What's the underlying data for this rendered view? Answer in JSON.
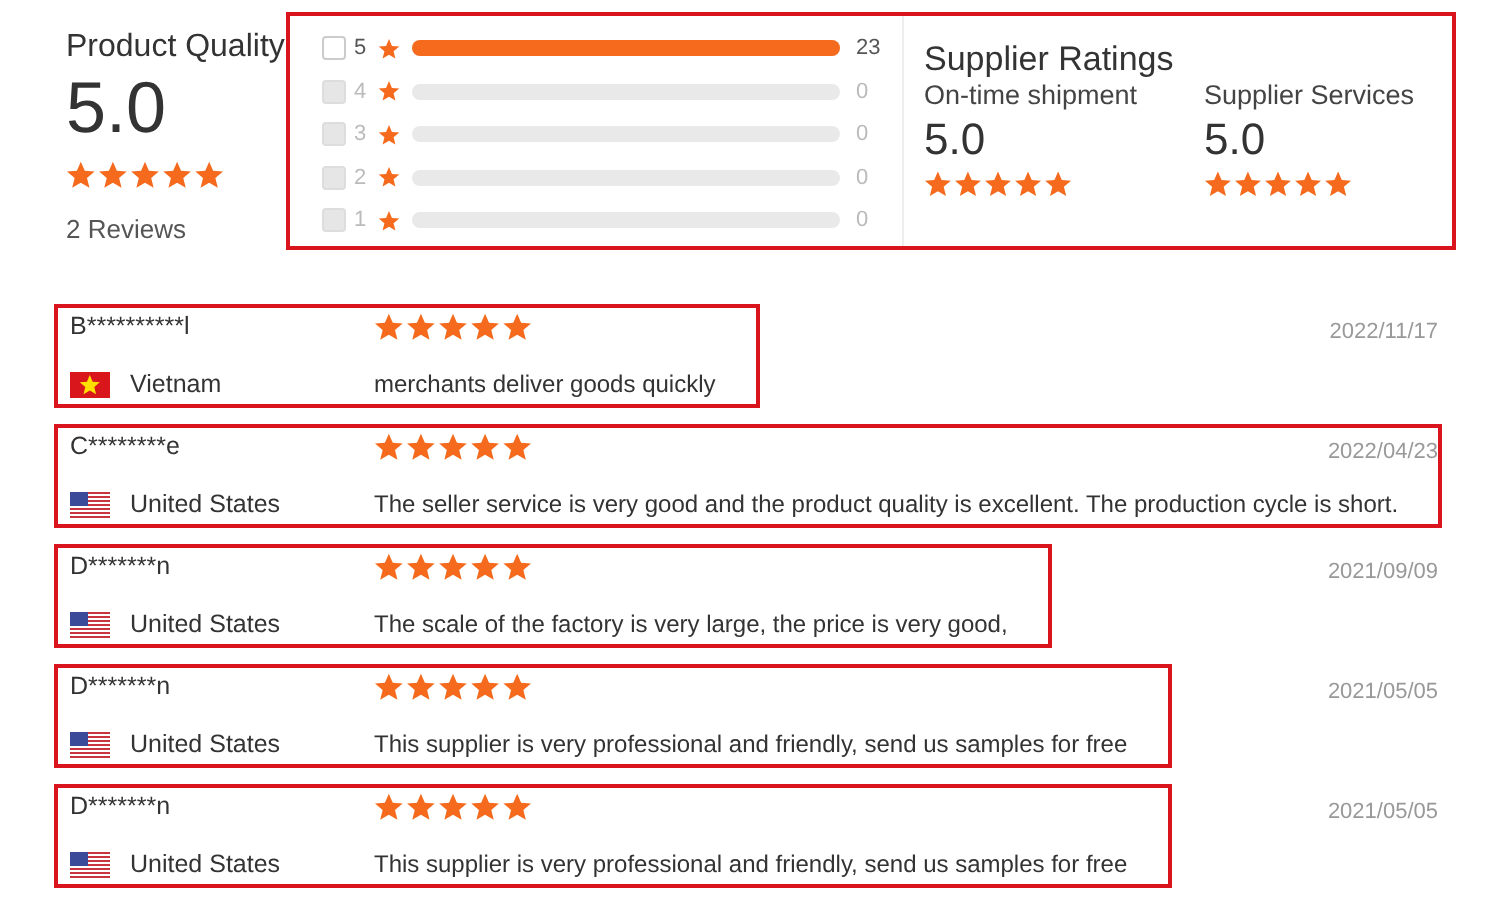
{
  "product_quality": {
    "title": "Product Quality",
    "score": "5.0",
    "stars": 5,
    "reviews_count": "2 Reviews"
  },
  "distribution": [
    {
      "label": "5",
      "disabled": false,
      "level": 1,
      "count": "23"
    },
    {
      "label": "4",
      "disabled": true,
      "level": 0,
      "count": "0"
    },
    {
      "label": "3",
      "disabled": true,
      "level": 0,
      "count": "0"
    },
    {
      "label": "2",
      "disabled": true,
      "level": 0,
      "count": "0"
    },
    {
      "label": "1",
      "disabled": true,
      "level": 0,
      "count": "0"
    }
  ],
  "supplier_ratings": {
    "title": "Supplier Ratings",
    "items": [
      {
        "label": "On-time shipment",
        "score": "5.0",
        "stars": 5
      },
      {
        "label": "Supplier Services",
        "score": "5.0",
        "stars": 5
      }
    ]
  },
  "reviews": [
    {
      "name": "B**********l",
      "country": {
        "name": "Vietnam",
        "kind": "vn"
      },
      "stars": 5,
      "comment": "merchants deliver goods quickly",
      "date": "2022/11/17"
    },
    {
      "name": "C********e",
      "country": {
        "name": "United States",
        "kind": "us"
      },
      "stars": 5,
      "comment": "The seller service is very good and the product quality is excellent. The production cycle is short.",
      "date": "2022/04/23"
    },
    {
      "name": "D*******n",
      "country": {
        "name": "United States",
        "kind": "us"
      },
      "stars": 5,
      "comment": "The scale of the factory is very large, the price is very good,",
      "date": "2021/09/09"
    },
    {
      "name": "D*******n",
      "country": {
        "name": "United States",
        "kind": "us"
      },
      "stars": 5,
      "comment": "This supplier is very professional and friendly, send us samples for free",
      "date": "2021/05/05"
    },
    {
      "name": "D*******n",
      "country": {
        "name": "United States",
        "kind": "us"
      },
      "stars": 5,
      "comment": "This supplier is very professional and friendly, send us samples for free",
      "date": "2021/05/05"
    }
  ]
}
